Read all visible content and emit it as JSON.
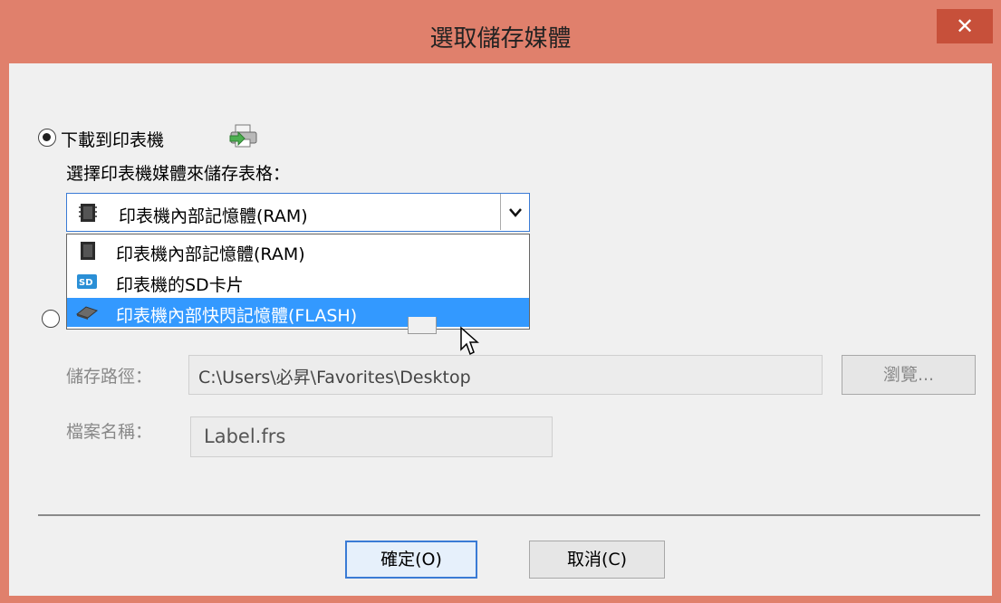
{
  "window": {
    "title": "選取儲存媒體",
    "close_label": "✕"
  },
  "download_option": {
    "label": "下載到印表機",
    "selected": true
  },
  "media_prompt": "選擇印表機媒體來儲存表格：",
  "media_combo": {
    "selected_value": "印表機內部記憶體(RAM)",
    "options": [
      {
        "label": "印表機內部記憶體(RAM)",
        "icon": "memory-chip-icon"
      },
      {
        "label": "印表機的SD卡片",
        "icon": "sd-card-icon"
      },
      {
        "label": "印表機內部快閃記憶體(FLASH)",
        "icon": "flash-drive-icon"
      }
    ],
    "highlighted_index": 2
  },
  "save_option": {
    "selected": false
  },
  "save_path": {
    "label": "儲存路徑：",
    "value": "C:\\Users\\必昇\\Favorites\\Desktop",
    "browse_label": "瀏覽..."
  },
  "file_name": {
    "label": "檔案名稱：",
    "value": "Label.frs"
  },
  "buttons": {
    "ok_label": "確定(O)",
    "cancel_label": "取消(C)"
  },
  "colors": {
    "title_bar": "#e0806c",
    "close_button": "#c7503a",
    "selection": "#3399ff",
    "focus_border": "#3a7bd5"
  }
}
